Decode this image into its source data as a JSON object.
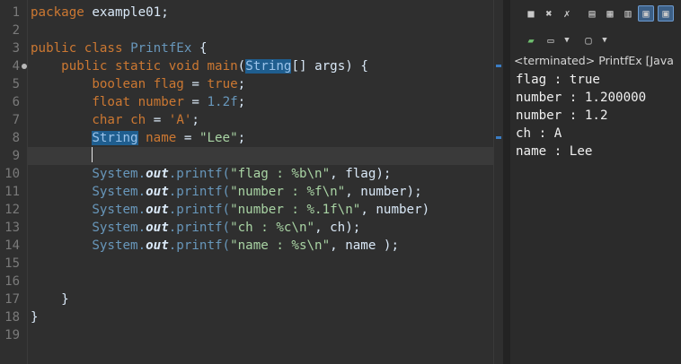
{
  "editor": {
    "line_numbers": [
      "1",
      "2",
      "3",
      "4",
      "5",
      "6",
      "7",
      "8",
      "9",
      "10",
      "11",
      "12",
      "13",
      "14",
      "15",
      "16",
      "17",
      "18",
      "19"
    ],
    "lines": [
      [
        {
          "t": "package",
          "c": "kw"
        },
        {
          "t": " example01;",
          "c": ""
        }
      ],
      [],
      [
        {
          "t": "public",
          "c": "kw"
        },
        {
          "t": " ",
          "c": ""
        },
        {
          "t": "class",
          "c": "kw"
        },
        {
          "t": " ",
          "c": ""
        },
        {
          "t": "PrintfEx",
          "c": "type"
        },
        {
          "t": " {",
          "c": ""
        }
      ],
      [
        {
          "t": "    ",
          "c": ""
        },
        {
          "t": "public",
          "c": "kw"
        },
        {
          "t": " ",
          "c": ""
        },
        {
          "t": "static",
          "c": "kw"
        },
        {
          "t": " ",
          "c": ""
        },
        {
          "t": "void",
          "c": "kw"
        },
        {
          "t": " ",
          "c": ""
        },
        {
          "t": "main",
          "c": "kw"
        },
        {
          "t": "(",
          "c": ""
        },
        {
          "t": "String",
          "c": "hl"
        },
        {
          "t": "[] args) {",
          "c": ""
        }
      ],
      [
        {
          "t": "        ",
          "c": ""
        },
        {
          "t": "boolean",
          "c": "kw"
        },
        {
          "t": " ",
          "c": ""
        },
        {
          "t": "flag",
          "c": "kw"
        },
        {
          "t": " = ",
          "c": ""
        },
        {
          "t": "true",
          "c": "kw"
        },
        {
          "t": ";",
          "c": ""
        }
      ],
      [
        {
          "t": "        ",
          "c": ""
        },
        {
          "t": "float",
          "c": "kw"
        },
        {
          "t": " ",
          "c": ""
        },
        {
          "t": "number",
          "c": "kw"
        },
        {
          "t": " = ",
          "c": ""
        },
        {
          "t": "1.2f",
          "c": "num"
        },
        {
          "t": ";",
          "c": ""
        }
      ],
      [
        {
          "t": "        ",
          "c": ""
        },
        {
          "t": "char",
          "c": "kw"
        },
        {
          "t": " ",
          "c": ""
        },
        {
          "t": "ch",
          "c": "kw"
        },
        {
          "t": " = ",
          "c": ""
        },
        {
          "t": "'A'",
          "c": "kw"
        },
        {
          "t": ";",
          "c": ""
        }
      ],
      [
        {
          "t": "        ",
          "c": ""
        },
        {
          "t": "String",
          "c": "hl"
        },
        {
          "t": " ",
          "c": ""
        },
        {
          "t": "name",
          "c": "kw"
        },
        {
          "t": " = ",
          "c": ""
        },
        {
          "t": "\"Lee\"",
          "c": "str"
        },
        {
          "t": ";",
          "c": ""
        }
      ],
      [
        {
          "t": "        ",
          "c": ""
        },
        {
          "t": "",
          "c": "caret"
        }
      ],
      [
        {
          "t": "        System.",
          "c": "type"
        },
        {
          "t": "out",
          "c": "field"
        },
        {
          "t": ".printf(",
          "c": "type"
        },
        {
          "t": "\"flag : %b\\n\"",
          "c": "str"
        },
        {
          "t": ", flag);",
          "c": ""
        }
      ],
      [
        {
          "t": "        System.",
          "c": "type"
        },
        {
          "t": "out",
          "c": "field"
        },
        {
          "t": ".printf(",
          "c": "type"
        },
        {
          "t": "\"number : %f\\n\"",
          "c": "str"
        },
        {
          "t": ", number);",
          "c": ""
        }
      ],
      [
        {
          "t": "        System.",
          "c": "type"
        },
        {
          "t": "out",
          "c": "field"
        },
        {
          "t": ".printf(",
          "c": "type"
        },
        {
          "t": "\"number : %.1f\\n\"",
          "c": "str"
        },
        {
          "t": ", number)",
          "c": ""
        }
      ],
      [
        {
          "t": "        System.",
          "c": "type"
        },
        {
          "t": "out",
          "c": "field"
        },
        {
          "t": ".printf(",
          "c": "type"
        },
        {
          "t": "\"ch : %c\\n\"",
          "c": "str"
        },
        {
          "t": ", ch);",
          "c": ""
        }
      ],
      [
        {
          "t": "        System.",
          "c": "type"
        },
        {
          "t": "out",
          "c": "field"
        },
        {
          "t": ".printf(",
          "c": "type"
        },
        {
          "t": "\"name : %s\\n\"",
          "c": "str"
        },
        {
          "t": ", name );",
          "c": ""
        }
      ],
      [],
      [],
      [
        {
          "t": "    }",
          "c": ""
        }
      ],
      [
        {
          "t": "}",
          "c": ""
        }
      ],
      []
    ],
    "current_line": 9
  },
  "console": {
    "status": "<terminated> PrintfEx [Java",
    "output": [
      "flag : true",
      "number : 1.200000",
      "number : 1.2",
      "ch : A",
      "name : Lee"
    ],
    "toolbar_icons": [
      "stop-icon",
      "remove-launch-icon",
      "remove-all-icon",
      "scroll-lock-icon",
      "word-wrap-icon",
      "pin-icon",
      "display-console-icon",
      "new-console-icon"
    ],
    "toolbar2_icons": [
      "open-console-icon",
      "display-selected-console-icon",
      "dropdown-icon",
      "new-console-view-icon",
      "dropdown-icon"
    ]
  }
}
